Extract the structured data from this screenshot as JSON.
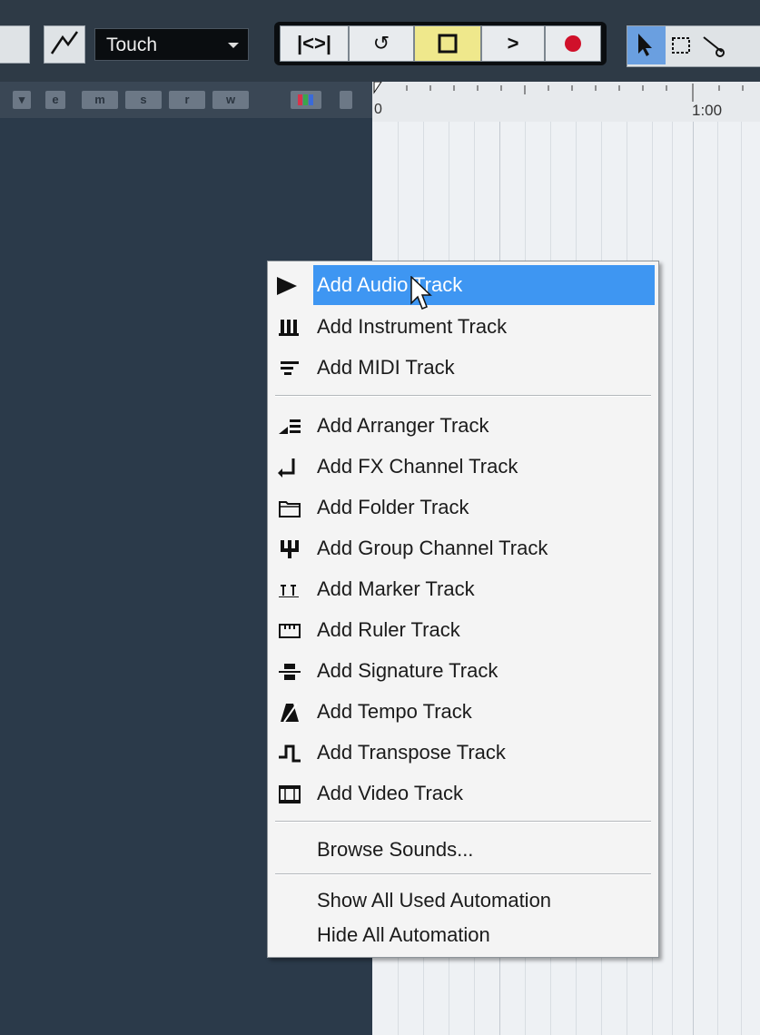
{
  "toolbar": {
    "automation_mode": "Touch",
    "transport": {
      "goto_start_glyph": "|<",
      "goto_end_glyph": ">|",
      "cycle_glyph": "↺",
      "play_glyph": ">"
    },
    "accent_color": "#efe88c"
  },
  "track_header_bar": {
    "buttons": [
      "m",
      "s",
      "r",
      "w"
    ]
  },
  "ruler": {
    "left_label": "0",
    "marker_label": "1:00"
  },
  "context_menu": {
    "highlight_color": "#3e96f2",
    "items": [
      {
        "label": "Add Audio Track",
        "icon": "play-triangle-icon"
      },
      {
        "label": "Add Instrument Track",
        "icon": "piano-keys-icon"
      },
      {
        "label": "Add MIDI Track",
        "icon": "midi-bars-icon"
      },
      {
        "label": "Add Arranger Track",
        "icon": "arranger-icon"
      },
      {
        "label": "Add FX Channel Track",
        "icon": "fx-channel-icon"
      },
      {
        "label": "Add Folder Track",
        "icon": "folder-icon"
      },
      {
        "label": "Add Group Channel Track",
        "icon": "group-channel-icon"
      },
      {
        "label": "Add Marker Track",
        "icon": "marker-icon"
      },
      {
        "label": "Add Ruler Track",
        "icon": "ruler-icon"
      },
      {
        "label": "Add Signature Track",
        "icon": "signature-icon"
      },
      {
        "label": "Add Tempo Track",
        "icon": "metronome-icon"
      },
      {
        "label": "Add Transpose Track",
        "icon": "transpose-icon"
      },
      {
        "label": "Add Video Track",
        "icon": "film-icon"
      }
    ],
    "browse_label": "Browse Sounds...",
    "automation_items": [
      "Show All Used Automation",
      "Hide All Automation"
    ]
  }
}
